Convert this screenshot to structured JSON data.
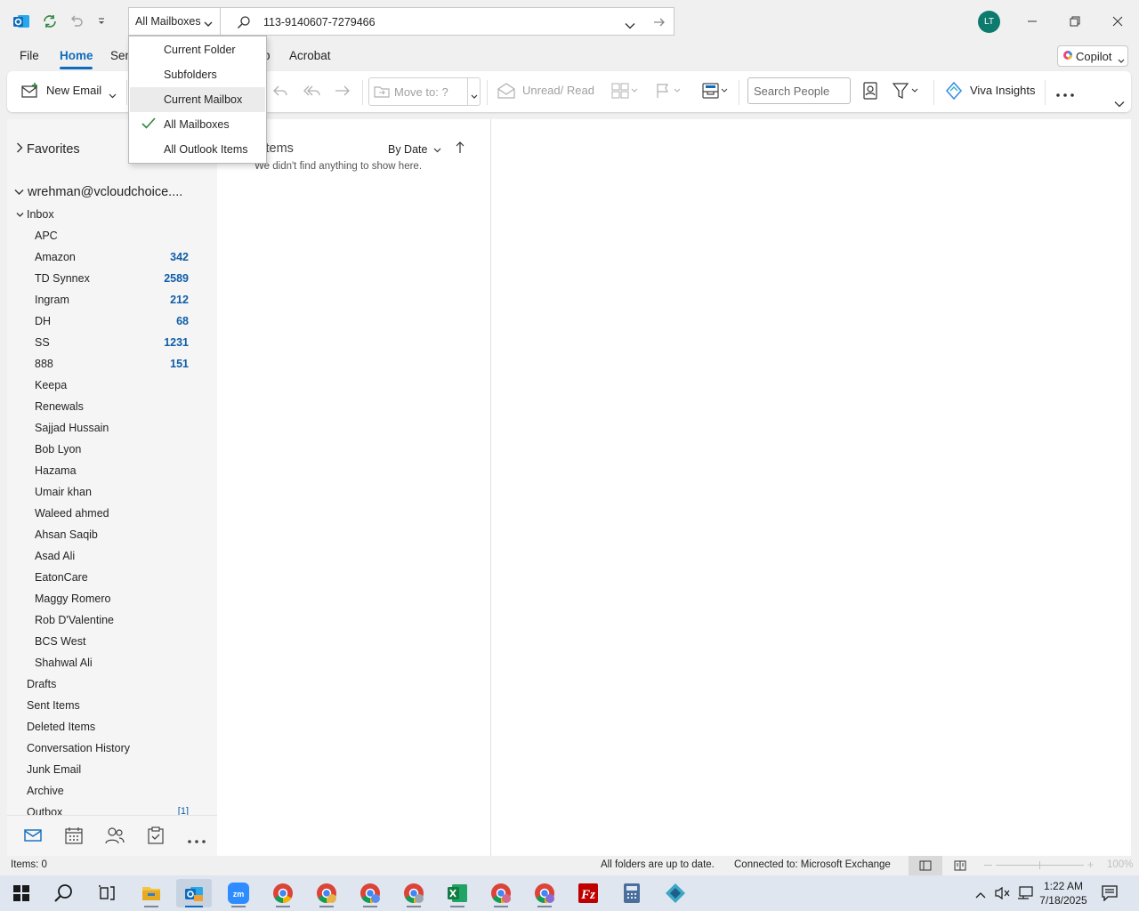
{
  "titlebar": {
    "scope_selected": "All Mailboxes",
    "search_query": "113-9140607-7279466",
    "avatar_initials": "LT",
    "accent_color": "#0f6cbd"
  },
  "tabs": [
    "File",
    "Home",
    "Send / Receive",
    "Help",
    "Acrobat"
  ],
  "tabs_visible": {
    "file": "File",
    "home": "Home",
    "send": "Sen",
    "help": "p",
    "acrobat": "Acrobat"
  },
  "copilot_label": "Copilot",
  "ribbon": {
    "new_email": "New Email",
    "move_to": "Move to: ?",
    "unread_read": "Unread/ Read",
    "search_people_placeholder": "Search People",
    "viva_insights": "Viva Insights"
  },
  "scope_menu": {
    "items": [
      "Current Folder",
      "Subfolders",
      "Current Mailbox",
      "All Mailboxes",
      "All Outlook Items"
    ],
    "checked": "All Mailboxes",
    "hovered": "Current Mailbox"
  },
  "folder_pane": {
    "favorites": "Favorites",
    "account": "wrehman@vcloudchoice....",
    "inbox": "Inbox",
    "subfolders": [
      {
        "name": "APC",
        "count": ""
      },
      {
        "name": "Amazon",
        "count": "342"
      },
      {
        "name": "TD Synnex",
        "count": "2589"
      },
      {
        "name": "Ingram",
        "count": "212"
      },
      {
        "name": "DH",
        "count": "68"
      },
      {
        "name": "SS",
        "count": "1231"
      },
      {
        "name": "888",
        "count": "151"
      },
      {
        "name": "Keepa",
        "count": ""
      },
      {
        "name": "Renewals",
        "count": ""
      },
      {
        "name": "Sajjad Hussain",
        "count": ""
      },
      {
        "name": "Bob Lyon",
        "count": ""
      },
      {
        "name": "Hazama",
        "count": ""
      },
      {
        "name": "Umair khan",
        "count": ""
      },
      {
        "name": "Waleed ahmed",
        "count": ""
      },
      {
        "name": "Ahsan Saqib",
        "count": ""
      },
      {
        "name": "Asad Ali",
        "count": ""
      },
      {
        "name": "EatonCare",
        "count": ""
      },
      {
        "name": "Maggy Romero",
        "count": ""
      },
      {
        "name": "Rob D'Valentine",
        "count": ""
      },
      {
        "name": "BCS West",
        "count": ""
      },
      {
        "name": "Shahwal Ali",
        "count": ""
      }
    ],
    "top_folders": [
      {
        "name": "Drafts",
        "count": ""
      },
      {
        "name": "Sent Items",
        "count": ""
      },
      {
        "name": "Deleted Items",
        "count": ""
      },
      {
        "name": "Conversation History",
        "count": ""
      },
      {
        "name": "Junk Email",
        "count": ""
      },
      {
        "name": "Archive",
        "count": ""
      },
      {
        "name": "Outbox",
        "count": "[1]"
      }
    ]
  },
  "message_list": {
    "header": "All Items",
    "header_visible": "il Items",
    "sort_label": "By Date",
    "empty_text": "We didn't find anything to show here."
  },
  "statusbar": {
    "items": "Items: 0",
    "sync_status": "All folders are up to date.",
    "connection": "Connected to: Microsoft Exchange",
    "zoom": "100%"
  },
  "taskbar": {
    "time": "1:22 AM",
    "date": "7/18/2025"
  }
}
